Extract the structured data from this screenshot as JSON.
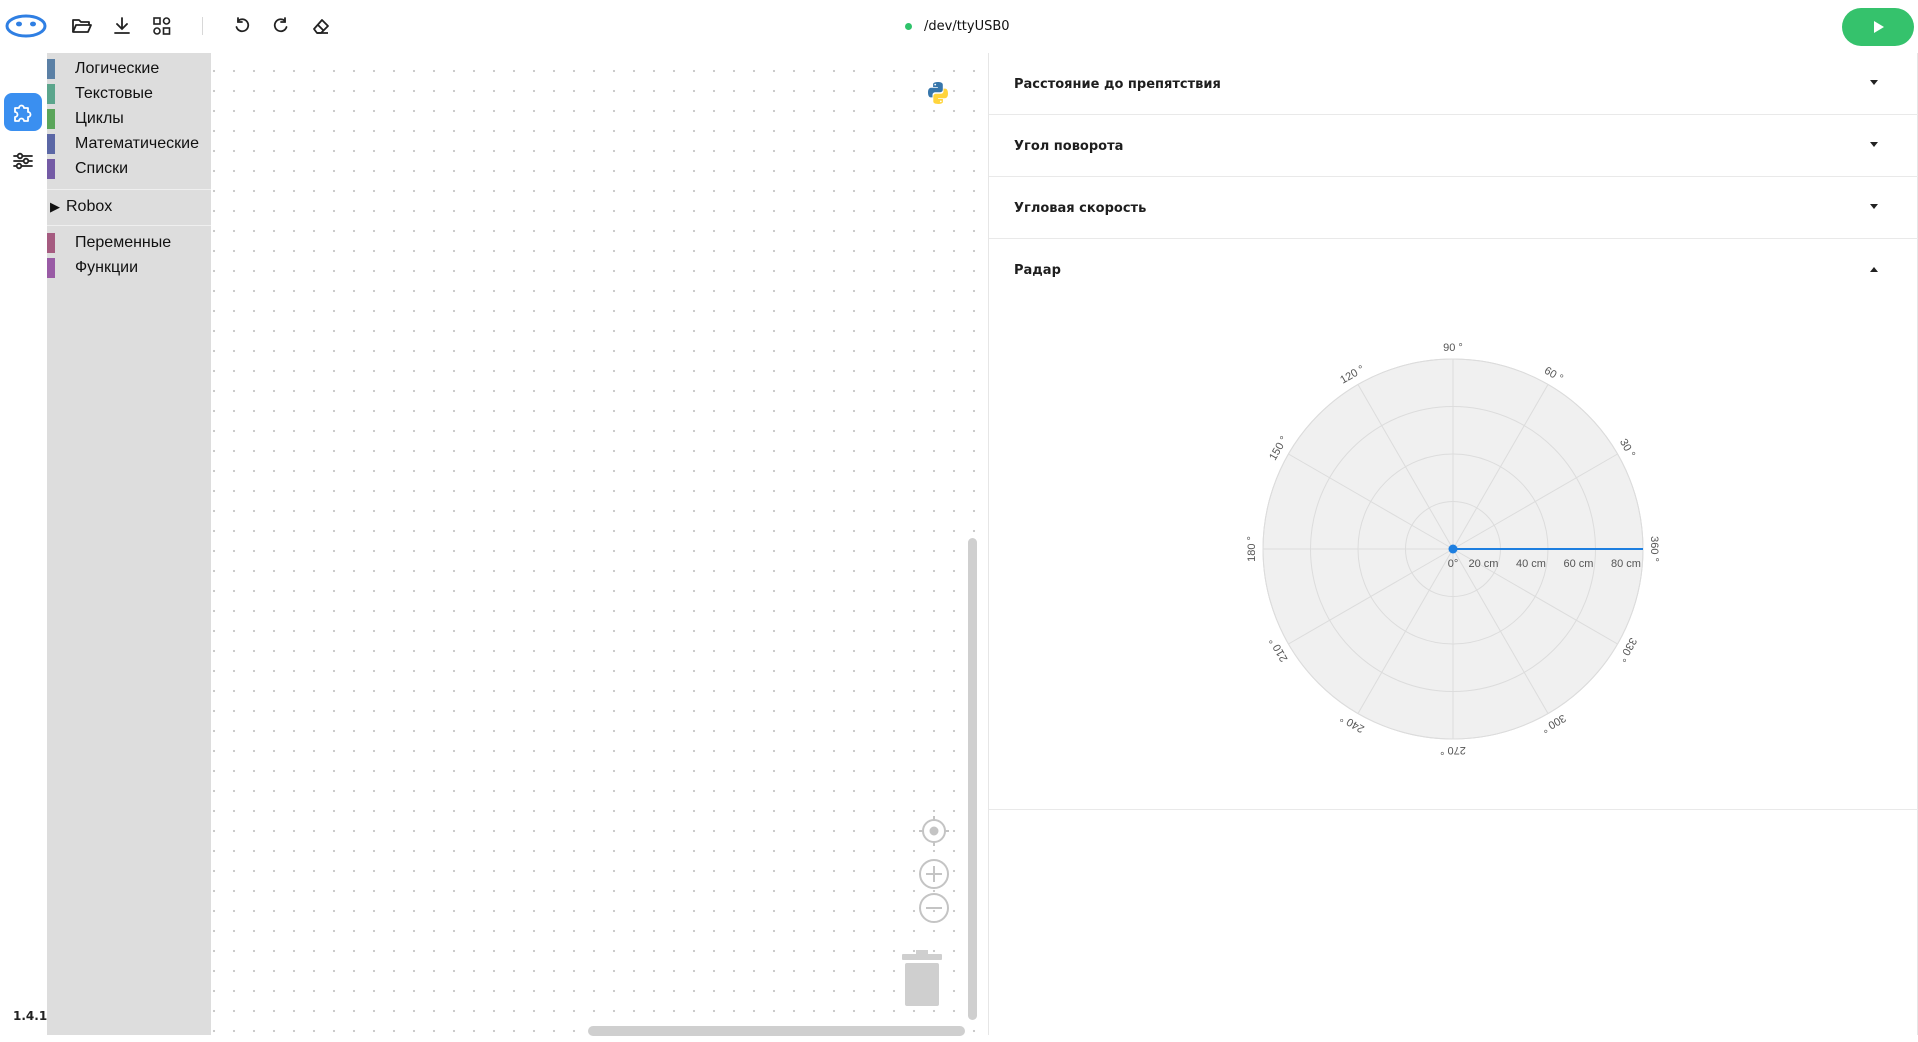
{
  "app": {
    "version": "1.4.1",
    "port": "/dev/ttyUSB0",
    "port_status_color": "#2fc36b",
    "accent": "#3a8ff0",
    "run_color": "#35c26c"
  },
  "toolbar": {
    "icons": [
      "logo-icon",
      "folder-open-icon",
      "download-icon",
      "shapes-icon",
      "undo-icon",
      "redo-icon",
      "eraser-icon",
      "play-icon"
    ]
  },
  "rail": {
    "items": [
      {
        "icon": "puzzle-icon",
        "active": true
      },
      {
        "icon": "sliders-icon",
        "active": false
      }
    ]
  },
  "toolbox": {
    "categories_top": [
      {
        "label": "Логические",
        "color": "#5b80a5"
      },
      {
        "label": "Текстовые",
        "color": "#5ba58c"
      },
      {
        "label": "Циклы",
        "color": "#5ba55b"
      },
      {
        "label": "Математические",
        "color": "#5b67a5"
      },
      {
        "label": "Списки",
        "color": "#745ba5"
      }
    ],
    "robox_label": "Robox",
    "categories_bottom": [
      {
        "label": "Переменные",
        "color": "#a55b80"
      },
      {
        "label": "Функции",
        "color": "#995ba5"
      }
    ]
  },
  "panels": [
    {
      "title": "Расстояние до препятствия",
      "expanded": false
    },
    {
      "title": "Угол поворота",
      "expanded": false
    },
    {
      "title": "Угловая скорость",
      "expanded": false
    },
    {
      "title": "Радар",
      "expanded": true
    }
  ],
  "radar": {
    "angle_labels": [
      "90 °",
      "60 °",
      "30 °",
      "360 °",
      "330 °",
      "300 °",
      "270 °",
      "240 °",
      "210 °",
      "180 °",
      "150 °",
      "120 °"
    ],
    "angle_values": [
      90,
      60,
      30,
      0,
      -30,
      -60,
      -90,
      -120,
      -150,
      180,
      150,
      120
    ],
    "radial_labels": [
      "20 cm",
      "40 cm",
      "60 cm",
      "80 cm"
    ],
    "radial_values": [
      20,
      40,
      60,
      80
    ],
    "center_label": "0°",
    "max_range": 80,
    "reading": {
      "angle": 0,
      "distance": 80
    },
    "line_color": "#1e7fe0"
  }
}
